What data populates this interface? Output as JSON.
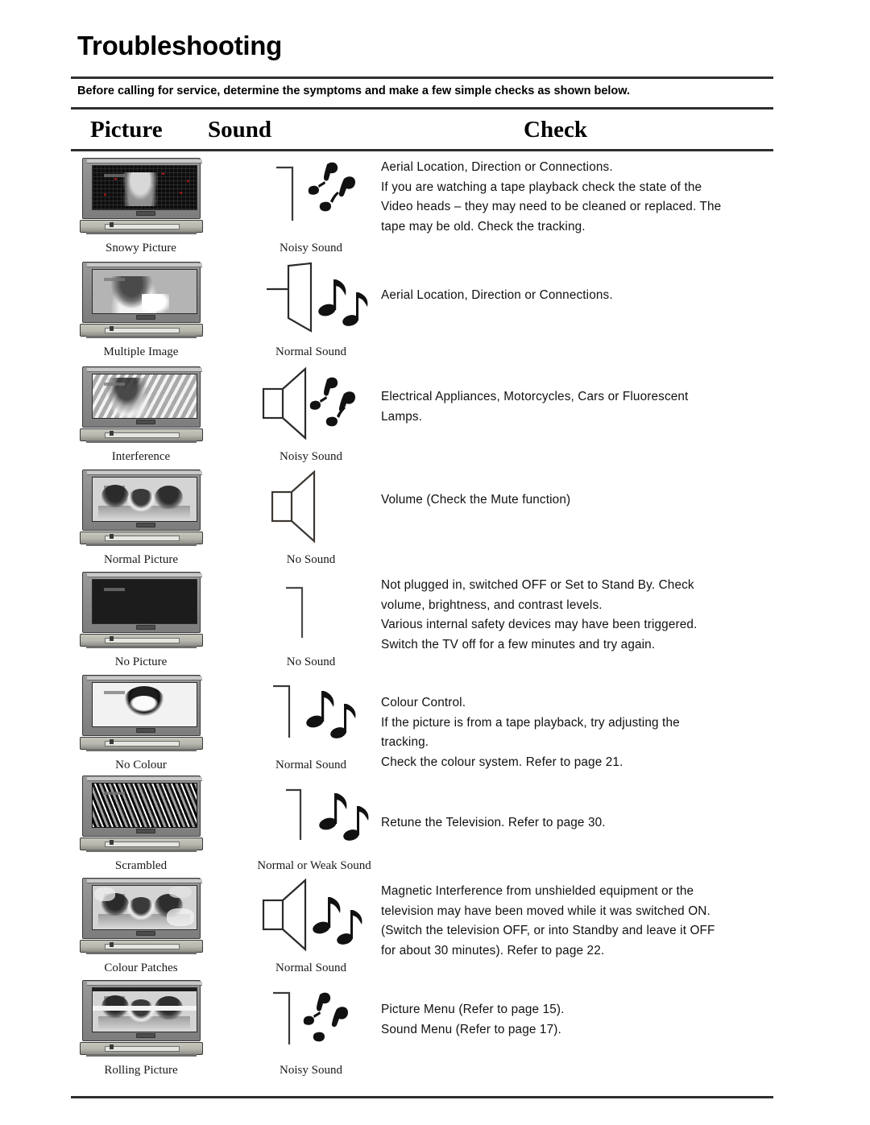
{
  "document": {
    "title": "Troubleshooting",
    "subheading": "Before calling for service, determine the symptoms and make a few simple checks as shown below.",
    "columns": {
      "picture": "Picture",
      "sound": "Sound",
      "check": "Check"
    }
  },
  "rows": [
    {
      "picture_caption": "Snowy Picture",
      "sound_caption": "Noisy Sound",
      "sound_icon": "collapsed-speaker-with-broken-notes-icon",
      "picture_icon": "television-snowy-icon",
      "check_lines": [
        "Aerial Location, Direction or Connections.",
        "If you are watching a tape playback check the state of the",
        "Video heads – they may need to be cleaned or replaced. The",
        "tape may be old. Check the tracking."
      ]
    },
    {
      "picture_caption": "Multiple Image",
      "sound_caption": "Normal Sound",
      "sound_icon": "open-speaker-with-music-notes-icon",
      "picture_icon": "television-multiple-image-icon",
      "check_lines": [
        "Aerial Location, Direction or Connections."
      ]
    },
    {
      "picture_caption": "Interference",
      "sound_caption": "Noisy Sound",
      "sound_icon": "boxed-speaker-with-broken-notes-icon",
      "picture_icon": "television-interference-icon",
      "check_lines": [
        "Electrical Appliances, Motorcycles, Cars or Fluorescent",
        "Lamps."
      ]
    },
    {
      "picture_caption": "Normal Picture",
      "sound_caption": "No Sound",
      "sound_icon": "boxed-speaker-silent-icon",
      "picture_icon": "television-normal-picture-icon",
      "check_lines": [
        "Volume (Check the Mute function)"
      ]
    },
    {
      "picture_caption": "No Picture",
      "sound_caption": "No Sound",
      "sound_icon": "collapsed-speaker-silent-icon",
      "picture_icon": "television-no-picture-icon",
      "check_lines": [
        "Not plugged in, switched OFF or Set to Stand By. Check",
        "volume, brightness, and contrast levels.",
        "Various internal safety devices may have been triggered.",
        "Switch the TV off for a few minutes and try again."
      ]
    },
    {
      "picture_caption": "No Colour",
      "sound_caption": "Normal Sound",
      "sound_icon": "collapsed-speaker-with-music-notes-icon",
      "picture_icon": "television-no-colour-icon",
      "check_lines": [
        "Colour Control.",
        "If the picture is from a tape playback, try adjusting the",
        "tracking.",
        "Check the colour system. Refer to page 21."
      ]
    },
    {
      "picture_caption": "Scrambled",
      "sound_caption": "Normal or Weak Sound",
      "sound_icon": "collapsed-speaker-with-music-notes-icon",
      "picture_icon": "television-scrambled-icon",
      "check_lines": [
        "Retune the Television. Refer to page 30."
      ]
    },
    {
      "picture_caption": "Colour Patches",
      "sound_caption": "Normal Sound",
      "sound_icon": "boxed-speaker-with-music-notes-icon",
      "picture_icon": "television-colour-patches-icon",
      "check_lines": [
        "Magnetic Interference from unshielded equipment or the",
        "television may have been moved while it was switched ON.",
        "(Switch the television OFF, or into Standby and leave it OFF",
        "for about 30 minutes). Refer to page 22."
      ]
    },
    {
      "picture_caption": "Rolling Picture",
      "sound_caption": "Noisy Sound",
      "sound_icon": "collapsed-speaker-with-broken-notes-icon",
      "picture_icon": "television-rolling-picture-icon",
      "check_lines": [
        "Picture Menu (Refer to page 15).",
        "Sound Menu (Refer to page 17)."
      ]
    }
  ],
  "colors": {
    "rule": "#2f2f2f",
    "text": "#111111",
    "caption": "#1a1a1a",
    "background": "#ffffff"
  }
}
